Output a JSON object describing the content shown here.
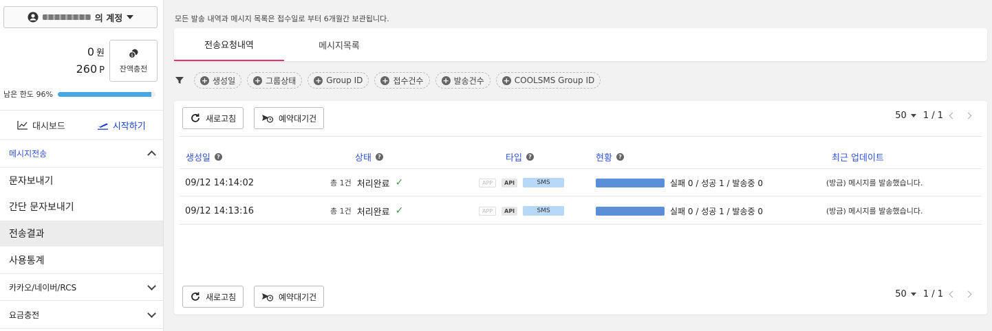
{
  "account": {
    "name_suffix": "의 계정"
  },
  "balance": {
    "won_value": "0",
    "won_unit": "원",
    "point_value": "260",
    "point_unit": "P",
    "charge_label": "잔액충전"
  },
  "limit": {
    "label": "남은 한도 96%",
    "percent": 96
  },
  "nav": {
    "dashboard": "대시보드",
    "get_started": "시작하기"
  },
  "sidebar": {
    "section_message": "메시지전송",
    "items": [
      "문자보내기",
      "간단 문자보내기",
      "전송결과",
      "사용통계"
    ],
    "section_kakao": "카카오/네이버/RCS",
    "section_billing": "요금충전"
  },
  "notice": "모든 발송 내역과 메시지 목록은 접수일로 부터 6개월간 보관됩니다.",
  "tabs": [
    "전송요청내역",
    "메시지목록"
  ],
  "filters": [
    "생성일",
    "그룹상태",
    "Group ID",
    "접수건수",
    "발송건수",
    "COOLSMS Group ID"
  ],
  "toolbar": {
    "refresh": "새로고침",
    "scheduled": "예약대기건"
  },
  "pager": {
    "page_size": "50",
    "pages": "1 / 1"
  },
  "table": {
    "headers": [
      "생성일",
      "상태",
      "타입",
      "현황",
      "최근 업데이트"
    ],
    "rows": [
      {
        "date": "09/12 14:14:02",
        "count": "총 1건",
        "status": "처리완료",
        "tags": [
          "APP",
          "API",
          "SMS"
        ],
        "progress": "실패 0 / 성공 1 / 발송중 0",
        "progress_pct": 100,
        "update": "(방금) 메시지를 발송했습니다."
      },
      {
        "date": "09/12 14:13:16",
        "count": "총 1건",
        "status": "처리완료",
        "tags": [
          "APP",
          "API",
          "SMS"
        ],
        "progress": "실패 0 / 성공 1 / 발송중 0",
        "progress_pct": 100,
        "update": "(방금) 메시지를 발송했습니다."
      }
    ]
  },
  "colors": {
    "accent_blue": "#3050d8",
    "tab_underline": "#e0356a",
    "progress": "#5b8fd8",
    "limit_bar": "#4aa6e0"
  }
}
